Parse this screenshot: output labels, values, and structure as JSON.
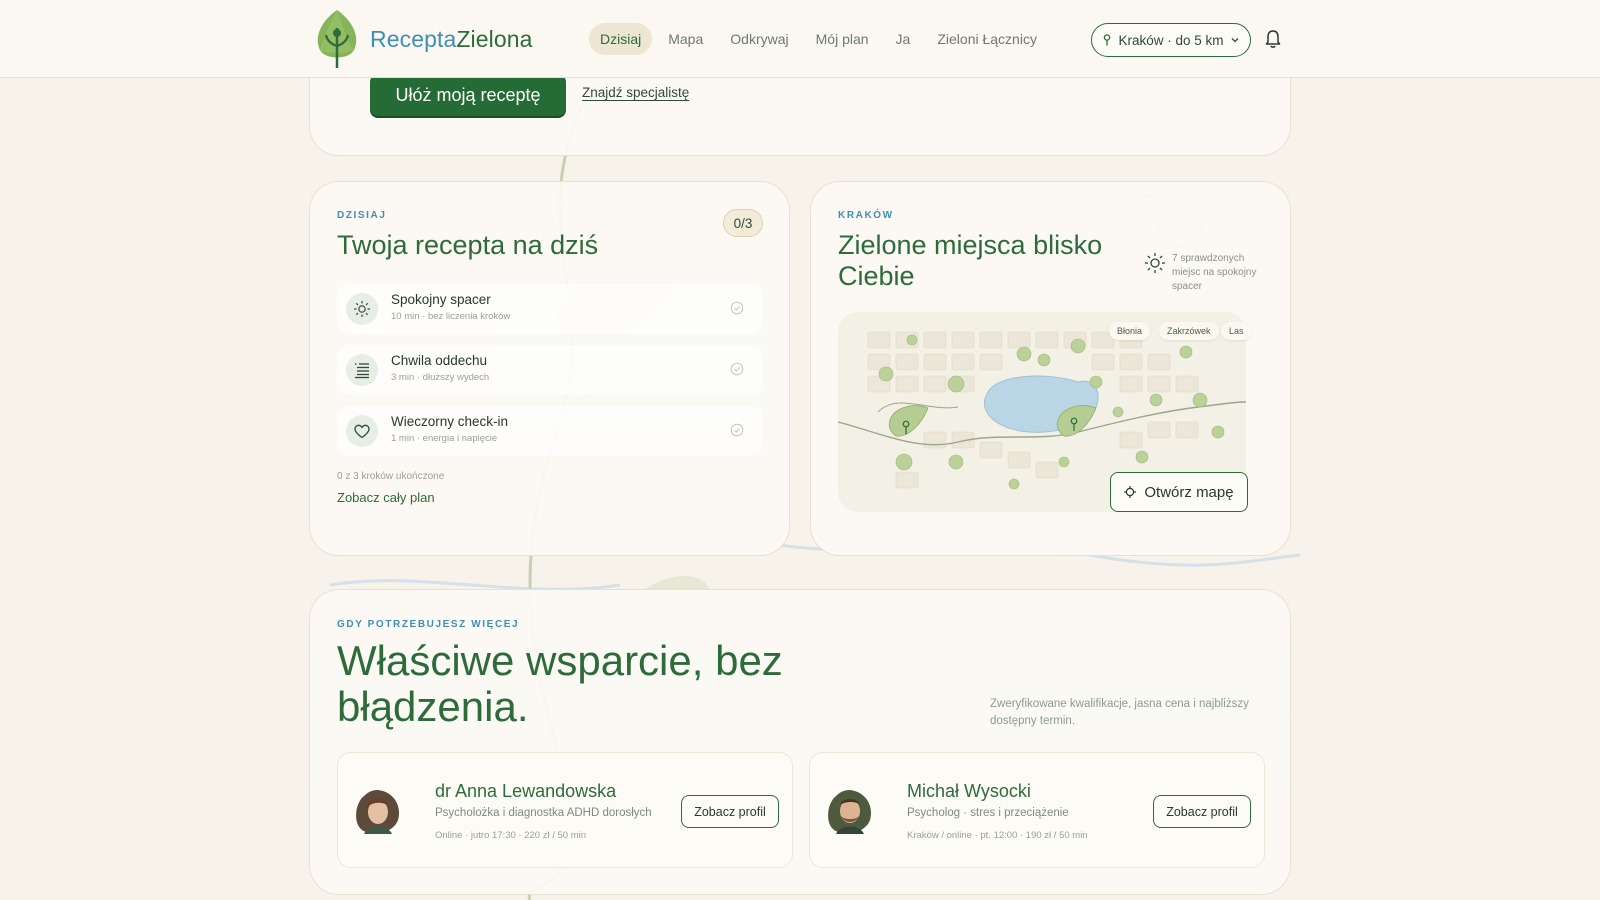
{
  "brand": {
    "name_part1": "Recepta",
    "name_part2": "Zielona"
  },
  "nav": {
    "items": [
      {
        "label": "Dzisiaj",
        "active": true
      },
      {
        "label": "Mapa",
        "active": false
      },
      {
        "label": "Odkrywaj",
        "active": false
      },
      {
        "label": "Mój plan",
        "active": false
      },
      {
        "label": "Ja",
        "active": false
      },
      {
        "label": "Zieloni Łącznicy",
        "active": false
      }
    ],
    "location_label": "Kraków · do 5 km"
  },
  "hero": {
    "cta_label": "Ułóż moją receptę",
    "link_label": "Znajdź specjalistę"
  },
  "plan": {
    "eyebrow": "DZISIAJ",
    "title": "Twoja recepta na dziś",
    "count": "0/3",
    "tasks": [
      {
        "title": "Spokojny spacer",
        "subtitle": "10 min · bez liczenia kroków",
        "icon": "sun-icon"
      },
      {
        "title": "Chwila oddechu",
        "subtitle": "3 min · dłuższy wydech",
        "icon": "lines-icon"
      },
      {
        "title": "Wieczorny check-in",
        "subtitle": "1 min · energia i napięcie",
        "icon": "heart-icon"
      }
    ],
    "progress_text": "0 z 3 kroków ukończone",
    "link_label": "Zobacz cały plan"
  },
  "map": {
    "eyebrow": "KRAKÓW",
    "title": "Zielone miejsca blisko Ciebie",
    "places_info": "7 sprawdzonych miejsc na spokojny spacer",
    "chips": [
      "Błonia",
      "Zakrzówek",
      "Las"
    ],
    "open_label": "Otwórz mapę"
  },
  "support": {
    "eyebrow": "GDY POTRZEBUJESZ WIĘCEJ",
    "title": "Właściwe wsparcie, bez błądzenia.",
    "description": "Zweryfikowane kwalifikacje, jasna cena i najbliższy dostępny termin.",
    "specialists": [
      {
        "name": "dr Anna Lewandowska",
        "role": "Psycholożka i diagnostka ADHD dorosłych",
        "meta": "Online · jutro 17:30 · 220 zł / 50 min",
        "button_label": "Zobacz profil"
      },
      {
        "name": "Michał Wysocki",
        "role": "Psycholog · stres i przeciążenie",
        "meta": "Kraków / online · pt. 12:00 · 190 zł / 50 min",
        "button_label": "Zobacz profil"
      }
    ]
  },
  "colors": {
    "accent_green": "#2e6b3a",
    "accent_blue": "#3f8fb5",
    "background": "#f7f3ea"
  }
}
